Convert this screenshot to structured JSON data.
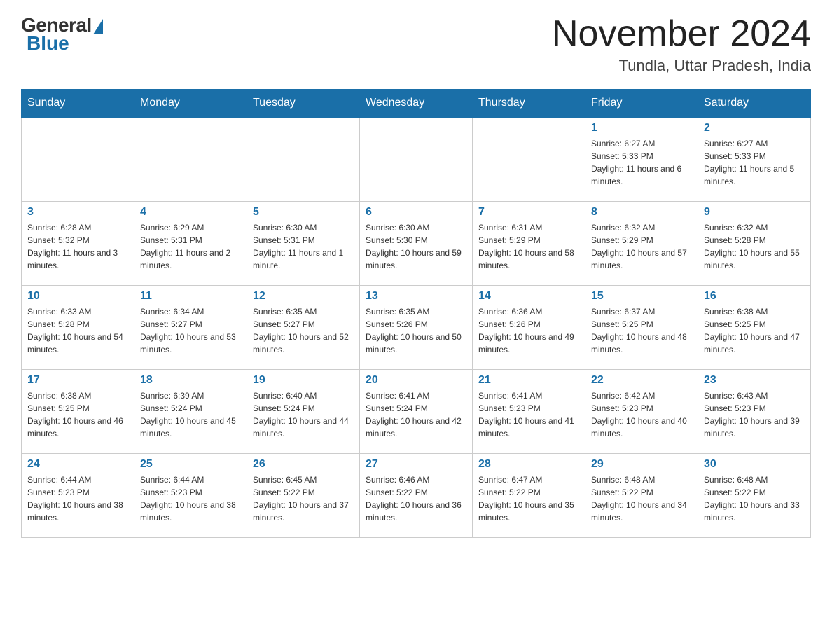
{
  "logo": {
    "general": "General",
    "blue": "Blue"
  },
  "header": {
    "month_year": "November 2024",
    "location": "Tundla, Uttar Pradesh, India"
  },
  "weekdays": [
    "Sunday",
    "Monday",
    "Tuesday",
    "Wednesday",
    "Thursday",
    "Friday",
    "Saturday"
  ],
  "weeks": [
    [
      {
        "day": "",
        "info": ""
      },
      {
        "day": "",
        "info": ""
      },
      {
        "day": "",
        "info": ""
      },
      {
        "day": "",
        "info": ""
      },
      {
        "day": "",
        "info": ""
      },
      {
        "day": "1",
        "info": "Sunrise: 6:27 AM\nSunset: 5:33 PM\nDaylight: 11 hours and 6 minutes."
      },
      {
        "day": "2",
        "info": "Sunrise: 6:27 AM\nSunset: 5:33 PM\nDaylight: 11 hours and 5 minutes."
      }
    ],
    [
      {
        "day": "3",
        "info": "Sunrise: 6:28 AM\nSunset: 5:32 PM\nDaylight: 11 hours and 3 minutes."
      },
      {
        "day": "4",
        "info": "Sunrise: 6:29 AM\nSunset: 5:31 PM\nDaylight: 11 hours and 2 minutes."
      },
      {
        "day": "5",
        "info": "Sunrise: 6:30 AM\nSunset: 5:31 PM\nDaylight: 11 hours and 1 minute."
      },
      {
        "day": "6",
        "info": "Sunrise: 6:30 AM\nSunset: 5:30 PM\nDaylight: 10 hours and 59 minutes."
      },
      {
        "day": "7",
        "info": "Sunrise: 6:31 AM\nSunset: 5:29 PM\nDaylight: 10 hours and 58 minutes."
      },
      {
        "day": "8",
        "info": "Sunrise: 6:32 AM\nSunset: 5:29 PM\nDaylight: 10 hours and 57 minutes."
      },
      {
        "day": "9",
        "info": "Sunrise: 6:32 AM\nSunset: 5:28 PM\nDaylight: 10 hours and 55 minutes."
      }
    ],
    [
      {
        "day": "10",
        "info": "Sunrise: 6:33 AM\nSunset: 5:28 PM\nDaylight: 10 hours and 54 minutes."
      },
      {
        "day": "11",
        "info": "Sunrise: 6:34 AM\nSunset: 5:27 PM\nDaylight: 10 hours and 53 minutes."
      },
      {
        "day": "12",
        "info": "Sunrise: 6:35 AM\nSunset: 5:27 PM\nDaylight: 10 hours and 52 minutes."
      },
      {
        "day": "13",
        "info": "Sunrise: 6:35 AM\nSunset: 5:26 PM\nDaylight: 10 hours and 50 minutes."
      },
      {
        "day": "14",
        "info": "Sunrise: 6:36 AM\nSunset: 5:26 PM\nDaylight: 10 hours and 49 minutes."
      },
      {
        "day": "15",
        "info": "Sunrise: 6:37 AM\nSunset: 5:25 PM\nDaylight: 10 hours and 48 minutes."
      },
      {
        "day": "16",
        "info": "Sunrise: 6:38 AM\nSunset: 5:25 PM\nDaylight: 10 hours and 47 minutes."
      }
    ],
    [
      {
        "day": "17",
        "info": "Sunrise: 6:38 AM\nSunset: 5:25 PM\nDaylight: 10 hours and 46 minutes."
      },
      {
        "day": "18",
        "info": "Sunrise: 6:39 AM\nSunset: 5:24 PM\nDaylight: 10 hours and 45 minutes."
      },
      {
        "day": "19",
        "info": "Sunrise: 6:40 AM\nSunset: 5:24 PM\nDaylight: 10 hours and 44 minutes."
      },
      {
        "day": "20",
        "info": "Sunrise: 6:41 AM\nSunset: 5:24 PM\nDaylight: 10 hours and 42 minutes."
      },
      {
        "day": "21",
        "info": "Sunrise: 6:41 AM\nSunset: 5:23 PM\nDaylight: 10 hours and 41 minutes."
      },
      {
        "day": "22",
        "info": "Sunrise: 6:42 AM\nSunset: 5:23 PM\nDaylight: 10 hours and 40 minutes."
      },
      {
        "day": "23",
        "info": "Sunrise: 6:43 AM\nSunset: 5:23 PM\nDaylight: 10 hours and 39 minutes."
      }
    ],
    [
      {
        "day": "24",
        "info": "Sunrise: 6:44 AM\nSunset: 5:23 PM\nDaylight: 10 hours and 38 minutes."
      },
      {
        "day": "25",
        "info": "Sunrise: 6:44 AM\nSunset: 5:23 PM\nDaylight: 10 hours and 38 minutes."
      },
      {
        "day": "26",
        "info": "Sunrise: 6:45 AM\nSunset: 5:22 PM\nDaylight: 10 hours and 37 minutes."
      },
      {
        "day": "27",
        "info": "Sunrise: 6:46 AM\nSunset: 5:22 PM\nDaylight: 10 hours and 36 minutes."
      },
      {
        "day": "28",
        "info": "Sunrise: 6:47 AM\nSunset: 5:22 PM\nDaylight: 10 hours and 35 minutes."
      },
      {
        "day": "29",
        "info": "Sunrise: 6:48 AM\nSunset: 5:22 PM\nDaylight: 10 hours and 34 minutes."
      },
      {
        "day": "30",
        "info": "Sunrise: 6:48 AM\nSunset: 5:22 PM\nDaylight: 10 hours and 33 minutes."
      }
    ]
  ]
}
